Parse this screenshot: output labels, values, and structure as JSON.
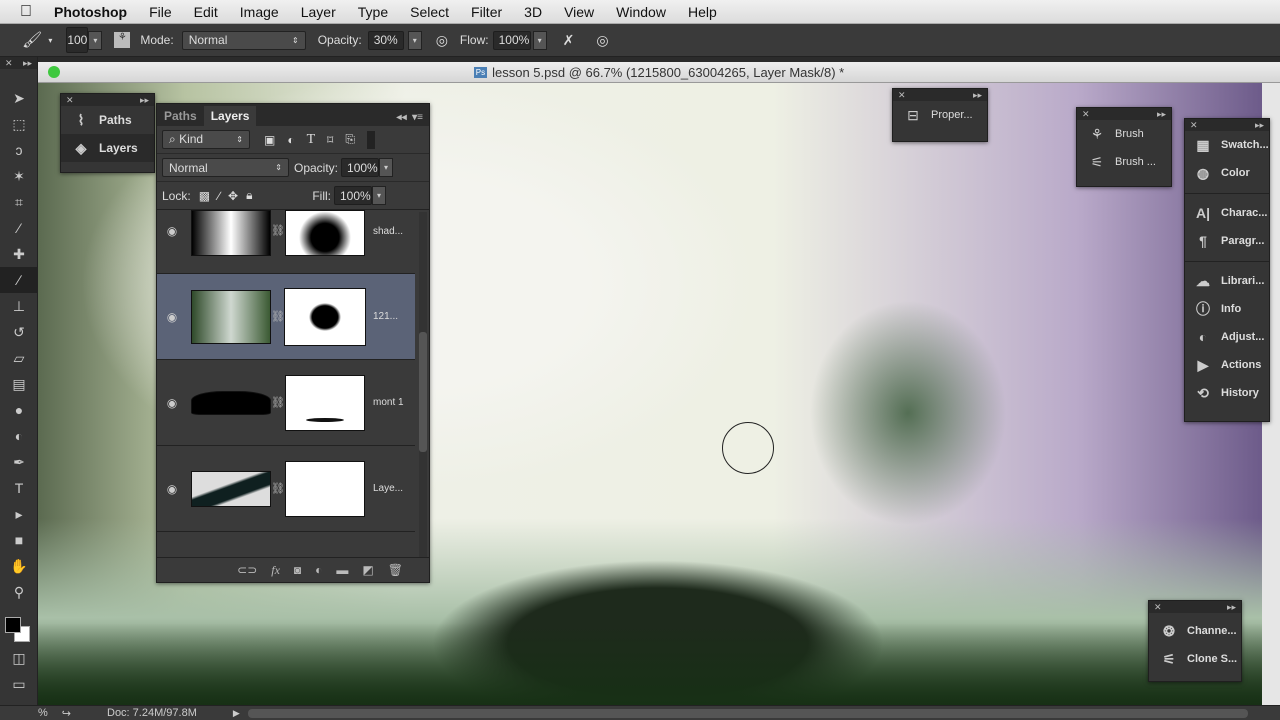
{
  "menubar": {
    "app": "Photoshop",
    "items": [
      "File",
      "Edit",
      "Image",
      "Layer",
      "Type",
      "Select",
      "Filter",
      "3D",
      "View",
      "Window",
      "Help"
    ]
  },
  "options": {
    "brush_size": "100",
    "mode_label": "Mode:",
    "mode_value": "Normal",
    "opacity_label": "Opacity:",
    "opacity_value": "30%",
    "flow_label": "Flow:",
    "flow_value": "100%"
  },
  "document": {
    "title": "lesson 5.psd @ 66.7% (1215800_63004265, Layer Mask/8) *"
  },
  "status": {
    "zoom_suffix": "%",
    "doc": "Doc: 7.24M/97.8M"
  },
  "mini_panel": {
    "items": [
      "Paths",
      "Layers"
    ]
  },
  "layers_panel": {
    "tabs": [
      "Paths",
      "Layers"
    ],
    "filter": "Kind",
    "blend": "Normal",
    "opacity_label": "Opacity:",
    "opacity": "100%",
    "lock_label": "Lock:",
    "fill_label": "Fill:",
    "fill": "100%",
    "layers": [
      {
        "name": "shad..."
      },
      {
        "name": "121..."
      },
      {
        "name": "mont 1"
      },
      {
        "name": "Laye..."
      }
    ]
  },
  "properties_panel": {
    "label": "Proper..."
  },
  "brush_panel": {
    "items": [
      "Brush",
      "Brush ..."
    ]
  },
  "right_panel": {
    "items": [
      "Swatch...",
      "Color",
      "Charac...",
      "Paragr...",
      "Librari...",
      "Info",
      "Adjust...",
      "Actions",
      "History"
    ]
  },
  "channels_panel": {
    "items": [
      "Channe...",
      "Clone S..."
    ]
  }
}
